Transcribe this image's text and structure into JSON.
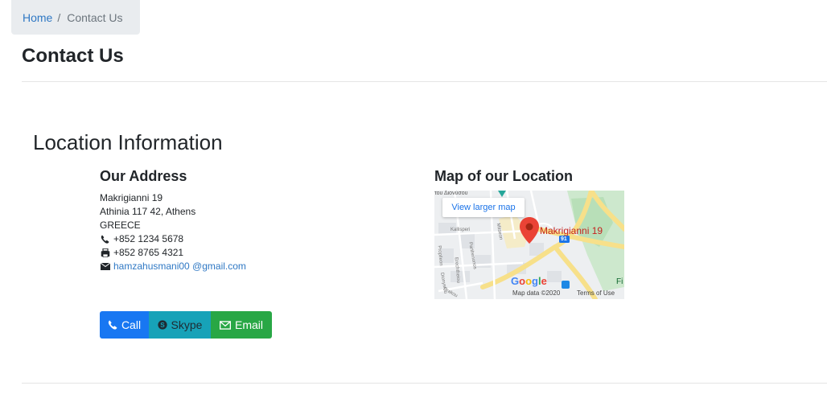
{
  "breadcrumb": {
    "home": "Home",
    "separator": "/",
    "current": "Contact Us"
  },
  "page_title": "Contact Us",
  "section_title": "Location Information",
  "address": {
    "heading": "Our Address",
    "line1": "Makrigianni 19",
    "line2": "Athinia 117 42, Athens",
    "line3": "GREECE",
    "phone": "+852 1234 5678",
    "fax": "+852 8765 4321",
    "email": "hamzahusmani00 @gmail.com"
  },
  "map": {
    "heading": "Map of our Location",
    "view_larger": "View larger map",
    "pin_label": "Makrigianni 19",
    "route_badge": "91",
    "map_data": "Map data ©2020",
    "terms": "Terms of Use",
    "google": "Google",
    "streets": [
      "Kallisperi",
      "Mitseon",
      "Propileon",
      "Parthenonos",
      "Erechtheiou",
      "Dionysiou",
      "Drakou",
      "Fi"
    ],
    "top_label": "του Διονύσου"
  },
  "buttons": {
    "call": "Call",
    "skype": "Skype",
    "email": "Email"
  },
  "colors": {
    "primary": "#1877f2",
    "info": "#17a2b8",
    "success": "#28a745",
    "link": "#2f78c4"
  }
}
